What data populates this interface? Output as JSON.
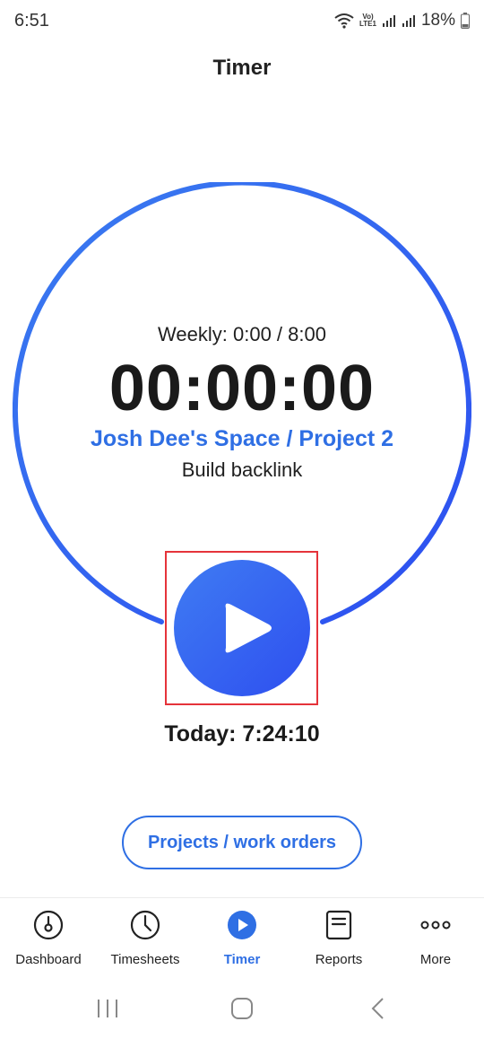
{
  "status_bar": {
    "time": "6:51",
    "network_top": "Vo)",
    "network_bottom": "LTE1",
    "battery": "18%"
  },
  "header": {
    "title": "Timer"
  },
  "timer": {
    "weekly": "Weekly: 0:00 / 8:00",
    "clock": "00:00:00",
    "project": "Josh Dee's Space / Project 2",
    "task": "Build backlink",
    "today": "Today: 7:24:10",
    "play_icon": "play-icon",
    "accent_color": "#2f6fe4"
  },
  "actions": {
    "projects_label": "Projects / work orders"
  },
  "bottom_nav": {
    "items": [
      {
        "label": "Dashboard",
        "icon": "dashboard-icon",
        "active": false
      },
      {
        "label": "Timesheets",
        "icon": "clock-icon",
        "active": false
      },
      {
        "label": "Timer",
        "icon": "play-circle-icon",
        "active": true
      },
      {
        "label": "Reports",
        "icon": "report-icon",
        "active": false
      },
      {
        "label": "More",
        "icon": "more-icon",
        "active": false
      }
    ]
  },
  "system_nav": {
    "icons": [
      "recent-apps-icon",
      "home-icon",
      "back-icon"
    ]
  }
}
